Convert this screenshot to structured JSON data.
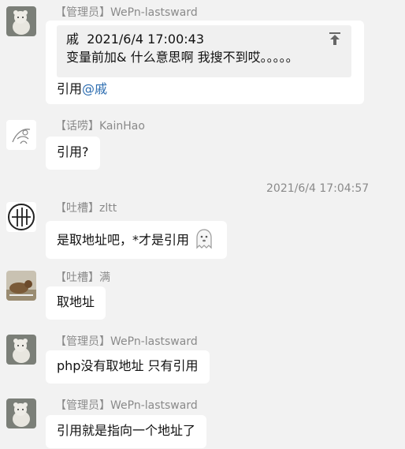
{
  "messages": [
    {
      "badge": "【管理员】",
      "sender": "WePn-lastsward",
      "quote": {
        "author": "戚",
        "time": "2021/6/4 17:00:43",
        "text": "变量前加& 什么意思啊 我搜不到哎。。。。。"
      },
      "text": "引用",
      "mention": "@戚"
    },
    {
      "badge": "【话唠】",
      "sender": "KainHao",
      "text": "引用?"
    },
    {
      "badge": "【吐槽】",
      "sender": "zltt",
      "text": "是取地址吧，*才是引用"
    },
    {
      "badge": "【吐槽】",
      "sender": "满",
      "text": "取地址"
    },
    {
      "badge": "【管理员】",
      "sender": "WePn-lastsward",
      "text": "php没有取地址 只有引用"
    },
    {
      "badge": "【管理员】",
      "sender": "WePn-lastsward",
      "text": "引用就是指向一个地址了"
    }
  ],
  "timestamp": "2021/6/4 17:04:57",
  "icons": {
    "avatar_admin": "bear-avatar-icon",
    "avatar_kainhao": "sketch-avatar-icon",
    "avatar_zltt": "circle-logo-avatar-icon",
    "avatar_man": "dog-photo-avatar-icon",
    "quote_action": "pin-to-top-icon",
    "sticker": "ghost-sticker-icon"
  },
  "colors": {
    "background": "#f2f2f2",
    "bubble": "#ffffff",
    "mention": "#2b6cb0"
  }
}
